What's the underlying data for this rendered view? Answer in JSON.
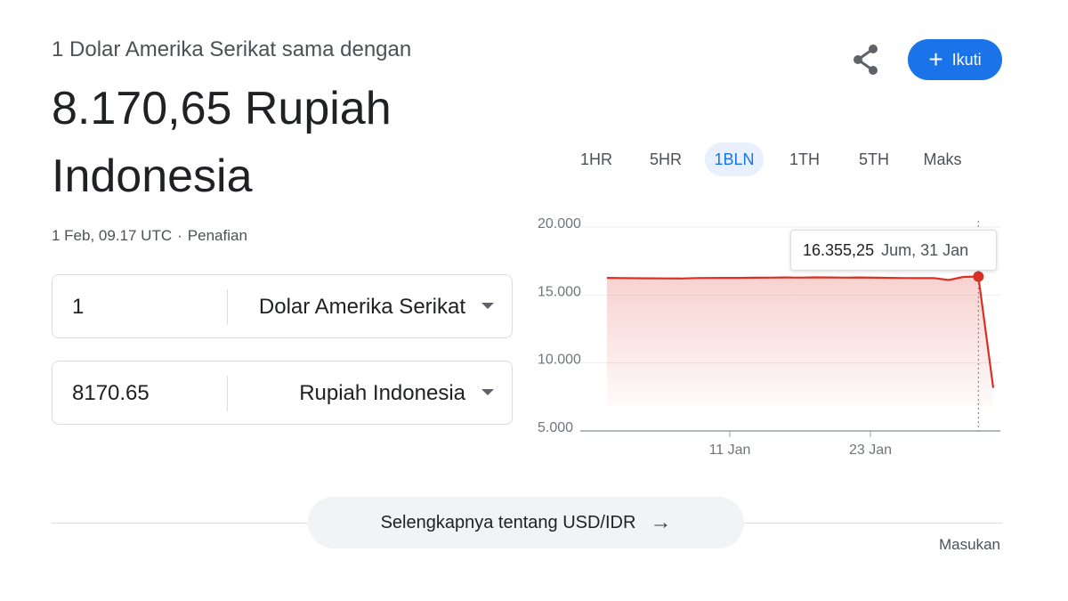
{
  "header": {
    "subtitle": "1 Dolar Amerika Serikat sama dengan",
    "result": "8.170,65 Rupiah Indonesia",
    "timestamp": "1 Feb, 09.17 UTC",
    "separator": "·",
    "disclaimer": "Penafian"
  },
  "actions": {
    "share_icon": "share-icon",
    "follow_label": "Ikuti",
    "follow_icon": "+",
    "accent_color": "#1a73e8"
  },
  "converter": {
    "from_amount": "1",
    "from_currency": "Dolar Amerika Serikat",
    "to_amount": "8170.65",
    "to_currency": "Rupiah Indonesia"
  },
  "range_tabs": [
    {
      "label": "1HR",
      "active": false
    },
    {
      "label": "5HR",
      "active": false
    },
    {
      "label": "1BLN",
      "active": true
    },
    {
      "label": "1TH",
      "active": false
    },
    {
      "label": "5TH",
      "active": false
    },
    {
      "label": "Maks",
      "active": false
    }
  ],
  "chart_data": {
    "type": "area",
    "line_color": "#d93025",
    "yticks": [
      "20.000",
      "15.000",
      "10.000",
      "5.000"
    ],
    "ytick_values": [
      20000,
      15000,
      10000,
      5000
    ],
    "xticks": [
      "11 Jan",
      "23 Jan"
    ],
    "ylim": [
      5000,
      20000
    ],
    "values": [
      16260,
      16240,
      16235,
      16230,
      16220,
      16215,
      16250,
      16255,
      16260,
      16262,
      16270,
      16280,
      16290,
      16280,
      16300,
      16290,
      16280,
      16290,
      16270,
      16260,
      16250,
      16240,
      16245,
      16100,
      16330,
      16355.25,
      8170.65
    ],
    "tooltip_value": "16.355,25",
    "tooltip_date": "Jum, 31 Jan"
  },
  "footer": {
    "more_label": "Selengkapnya tentang USD/IDR",
    "more_arrow": "→",
    "feedback": "Masukan"
  }
}
